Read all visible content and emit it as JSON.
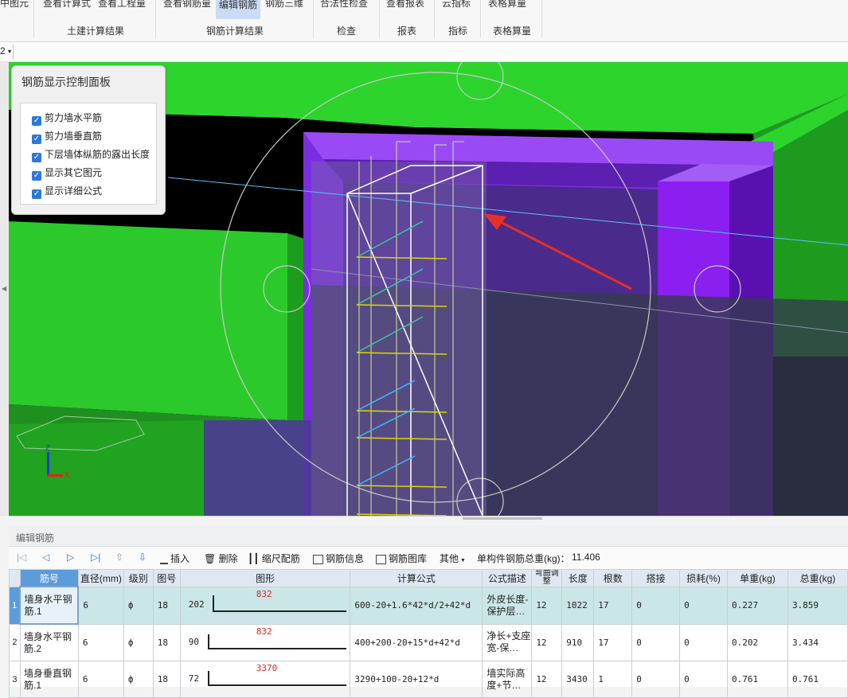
{
  "ribbon": {
    "top_buttons": [
      "中图元",
      "查看计算式",
      "查看工程量",
      "查看钢筋量",
      "编辑钢筋",
      "钢筋三维",
      "合法性检查",
      "查看报表",
      "云指标",
      "表格算量"
    ],
    "groups": [
      "土建计算结果",
      "钢筋计算结果",
      "检查",
      "报表",
      "指标",
      "表格算量"
    ]
  },
  "subbar": {
    "dropdown_value": "2"
  },
  "control_panel": {
    "title": "钢筋显示控制面板",
    "options": [
      "剪力墙水平筋",
      "剪力墙垂直筋",
      "下层墙体纵筋的露出长度",
      "显示其它图元",
      "显示详细公式"
    ]
  },
  "axes": {
    "z": "Z",
    "y": "Y",
    "x": "X"
  },
  "editor": {
    "title": "编辑钢筋",
    "toolbar": {
      "insert": "插入",
      "delete": "删除",
      "scale": "缩尺配筋",
      "info": "钢筋信息",
      "library": "钢筋图库",
      "other": "其他",
      "total_weight_label": "单构件钢筋总重(kg)：",
      "total_weight_value": "11.406"
    },
    "columns": [
      "筋号",
      "直径(mm)",
      "级别",
      "图号",
      "图形",
      "计算公式",
      "公式描述",
      "弯曲调整",
      "长度",
      "根数",
      "搭接",
      "损耗(%)",
      "单重(kg)",
      "总重(kg)"
    ],
    "rows": [
      {
        "no": "1",
        "name": "墙身水平钢筋.1",
        "dia": "6",
        "grade": "ф",
        "fig": "18",
        "shape_left": "202",
        "shape_mid": "832",
        "formula": "600-20+1.6*42*d/2+42*d",
        "desc": "外皮长度-保护层…",
        "bend": "12",
        "length": "1022",
        "count": "17",
        "lap": "0",
        "loss": "0",
        "unit": "0.227",
        "total": "3.859"
      },
      {
        "no": "2",
        "name": "墙身水平钢筋.2",
        "dia": "6",
        "grade": "ф",
        "fig": "18",
        "shape_left": "90",
        "shape_mid": "832",
        "formula": "400+200-20+15*d+42*d",
        "desc": "净长+支座宽-保…",
        "bend": "12",
        "length": "910",
        "count": "17",
        "lap": "0",
        "loss": "0",
        "unit": "0.202",
        "total": "3.434"
      },
      {
        "no": "3",
        "name": "墙身垂直钢筋.1",
        "dia": "6",
        "grade": "ф",
        "fig": "18",
        "shape_left": "72",
        "shape_mid": "3370",
        "formula": "3290+100-20+12*d",
        "desc": "墙实际高度+节…",
        "bend": "12",
        "length": "3430",
        "count": "1",
        "lap": "0",
        "loss": "0",
        "unit": "0.761",
        "total": "0.761"
      }
    ]
  },
  "colors": {
    "green": "#2cd42c",
    "purple": "#8a1ff0",
    "accent": "#5d9cdb",
    "arrow": "#e5302a"
  }
}
